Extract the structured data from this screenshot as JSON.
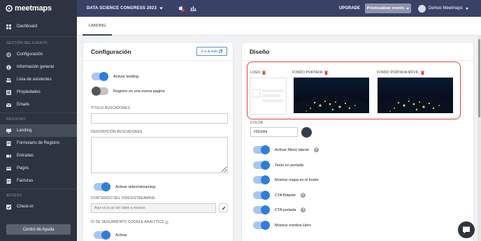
{
  "brand": {
    "name": "meetmaps"
  },
  "topbar": {
    "event_title": "DATA SCIENCE CONGRESS 2023",
    "upgrade": "UPGRADE",
    "preview": "Previsualizar evento",
    "user": "Demos Meetmaps"
  },
  "sidebar": {
    "dashboard": "Dashboard",
    "section_gestion": "GESTIÓN DEL EVENTO",
    "items_gestion": [
      "Configuración",
      "Información general",
      "Lista de asistentes",
      "Propiedades",
      "Emails"
    ],
    "section_registro": "REGISTRO",
    "items_registro": [
      "Landing",
      "Formulario de Registro",
      "Entradas",
      "Pagos",
      "Facturas"
    ],
    "section_acceso": "ACCESO",
    "items_acceso": [
      "Check-in"
    ],
    "help_button": "Centro de Ayuda"
  },
  "tabs": {
    "landing": "LANDING"
  },
  "config": {
    "title": "Configuración",
    "web_link": "Ir a la web",
    "activar_landing": "Activar landing",
    "registro_nueva_pagina": "Registro en una nueva página",
    "titulo_buscadores": "TITULO BUSCADORES",
    "descripcion_buscadores": "DESCRIPCIÓN BUSCADORES",
    "activar_video": "Activar video/streaming",
    "contenido_video": "CONTENIDO DEL VIDEO/STREAMING",
    "video_placeholder": "Aqui va la url del video a mostrar",
    "id_seguimiento": "ID DE SEGUIMIENTO GOOGLE ANALYTICS",
    "activar": "Activar"
  },
  "diseno": {
    "title": "Diseño",
    "logo": "LOGO",
    "fondo_portada": "FONDO PORTADA",
    "fondo_portada_movil": "FONDO PORTADA MÓVIL",
    "color_label": "COLOR",
    "color_value": "#363d4a",
    "toggles": [
      "Activar Menú lateral",
      "Texto en portada",
      "Mostrar mapa en el footer",
      "CTA flotante",
      "CTA portada",
      "Mostrar sombra Hero"
    ]
  },
  "colors": {
    "accent": "#2d7fde",
    "sidebar": "#2d3340",
    "topbar": "#3a4166",
    "highlight": "#e0433b"
  }
}
